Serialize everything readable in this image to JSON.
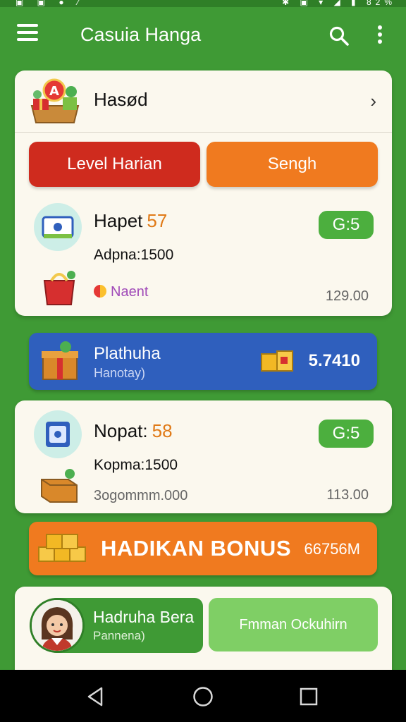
{
  "status_bar": {
    "left_icons": "▣ ▣ ● ⁄",
    "right_text": "✱ ▣ ▾ ◢ ▮ 82%"
  },
  "app_bar": {
    "title": "Casuia Hanga",
    "icons": [
      "menu-icon",
      "search-icon",
      "more-vert-icon"
    ]
  },
  "card_header": {
    "title": "Hasød",
    "chevron": "›"
  },
  "tabs": [
    {
      "label": "Level Harian",
      "color": "#cf2b1e"
    },
    {
      "label": "Sengh",
      "color": "#f07a1f"
    }
  ],
  "items": [
    {
      "title": "Hapet",
      "level": "57",
      "subtitle": "Adpna:1500",
      "badge": "G:5",
      "tag": "Naent",
      "amount": "129.00"
    },
    {
      "title": "Nopat:",
      "level": "58",
      "subtitle": "Kopma:1500",
      "badge": "G:5",
      "tag": "3ogommm.000",
      "amount": "113.00"
    }
  ],
  "promo_banner": {
    "title": "Plathuha",
    "subtitle": "Hanotay)",
    "value": "5.7410",
    "color": "#2f5fbd"
  },
  "bonus_banner": {
    "title": "HADIKAN BONUS",
    "value": "66756M",
    "color": "#f07a1f"
  },
  "profile": {
    "name": "Hadruha Bera",
    "subtitle": "Pannena)"
  },
  "secondary_button": {
    "label": "Fmman Ockuhirn"
  },
  "colors": {
    "primary": "#3f9a35",
    "accent_orange": "#f07a1f",
    "accent_red": "#cf2b1e",
    "card_bg": "#fbf8ee"
  }
}
